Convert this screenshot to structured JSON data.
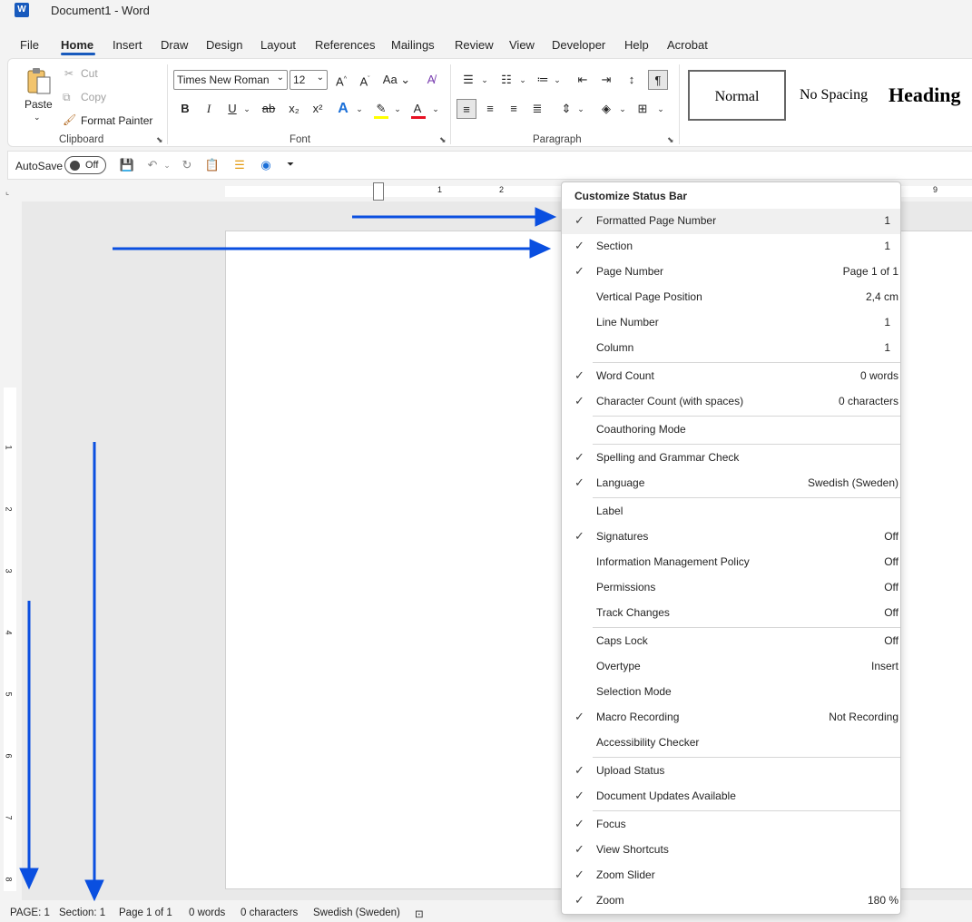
{
  "window": {
    "title": "Document1  -  Word",
    "logo": "W"
  },
  "menu_tabs": [
    "File",
    "Home",
    "Insert",
    "Draw",
    "Design",
    "Layout",
    "References",
    "Mailings",
    "Review",
    "View",
    "Developer",
    "Help",
    "Acrobat"
  ],
  "clipboard": {
    "paste": "Paste",
    "cut": "Cut",
    "copy": "Copy",
    "format_painter": "Format Painter",
    "group": "Clipboard"
  },
  "font": {
    "name": "Times New Roman",
    "size": "12",
    "group": "Font",
    "change_case": "Aa",
    "bold": "B",
    "italic": "I",
    "underline": "U",
    "strike": "ab",
    "subscript": "x₂",
    "superscript": "x²"
  },
  "paragraph": {
    "group": "Paragraph"
  },
  "styles": {
    "normal": "Normal",
    "no_spacing": "No Spacing",
    "heading": "Heading"
  },
  "qat": {
    "autosave": "AutoSave",
    "toggle": "Off"
  },
  "ruler_numbers_h": [
    "1",
    "2",
    "9"
  ],
  "ruler_numbers_v": [
    "1",
    "2",
    "3",
    "4",
    "5",
    "6",
    "7",
    "8"
  ],
  "status_bar": {
    "page": "PAGE: 1",
    "section": "Section: 1",
    "page_number": "Page 1 of 1",
    "words": "0 words",
    "characters": "0 characters",
    "language": "Swedish (Sweden)"
  },
  "context_menu": {
    "title": "Customize Status Bar",
    "groups": [
      [
        {
          "label": "Formatted Page Number",
          "value": "1",
          "checked": true
        },
        {
          "label": "Section",
          "value": "1",
          "checked": true
        },
        {
          "label": "Page Number",
          "value": "Page 1 of 1",
          "checked": true
        },
        {
          "label": "Vertical Page Position",
          "value": "2,4 cm",
          "checked": false
        },
        {
          "label": "Line Number",
          "value": "1",
          "checked": false
        },
        {
          "label": "Column",
          "value": "1",
          "checked": false
        }
      ],
      [
        {
          "label": "Word Count",
          "value": "0 words",
          "checked": true
        },
        {
          "label": "Character Count (with spaces)",
          "value": "0 characters",
          "checked": true
        }
      ],
      [
        {
          "label": "Coauthoring Mode",
          "value": "",
          "checked": false
        }
      ],
      [
        {
          "label": "Spelling and Grammar Check",
          "value": "",
          "checked": true
        },
        {
          "label": "Language",
          "value": "Swedish (Sweden)",
          "checked": true
        }
      ],
      [
        {
          "label": "Label",
          "value": "",
          "checked": false
        },
        {
          "label": "Signatures",
          "value": "Off",
          "checked": true
        },
        {
          "label": "Information Management Policy",
          "value": "Off",
          "checked": false
        },
        {
          "label": "Permissions",
          "value": "Off",
          "checked": false
        },
        {
          "label": "Track Changes",
          "value": "Off",
          "checked": false
        }
      ],
      [
        {
          "label": "Caps Lock",
          "value": "Off",
          "checked": false
        },
        {
          "label": "Overtype",
          "value": "Insert",
          "checked": false
        },
        {
          "label": "Selection Mode",
          "value": "",
          "checked": false
        },
        {
          "label": "Macro Recording",
          "value": "Not Recording",
          "checked": true
        },
        {
          "label": "Accessibility Checker",
          "value": "",
          "checked": false
        }
      ],
      [
        {
          "label": "Upload Status",
          "value": "",
          "checked": true
        },
        {
          "label": "Document Updates Available",
          "value": "",
          "checked": true
        }
      ],
      [
        {
          "label": "Focus",
          "value": "",
          "checked": true
        },
        {
          "label": "View Shortcuts",
          "value": "",
          "checked": true
        },
        {
          "label": "Zoom Slider",
          "value": "",
          "checked": true
        },
        {
          "label": "Zoom",
          "value": "180 %",
          "checked": true
        }
      ]
    ]
  },
  "colors": {
    "accent": "#185abd",
    "annotation_arrow": "#0a4fe0",
    "font_color_bar": "#e81123",
    "highlight_bar": "#ffff00"
  }
}
